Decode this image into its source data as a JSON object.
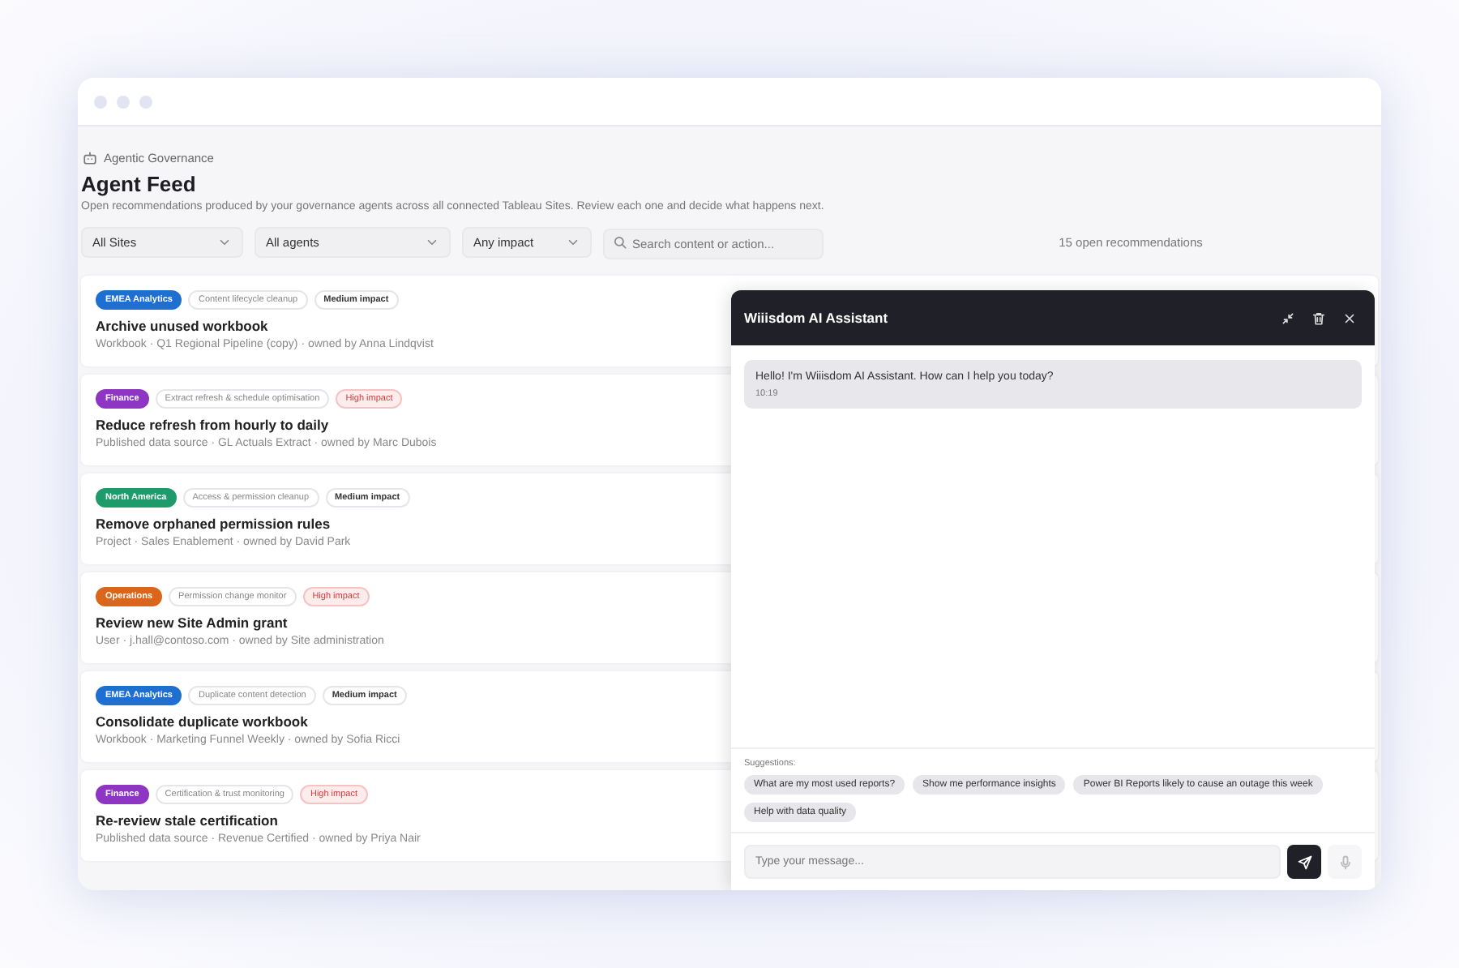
{
  "breadcrumb": "Agentic Governance",
  "title": "Agent Feed",
  "subtitle": "Open recommendations produced by your governance agents across all connected Tableau Sites. Review each one and decide what happens next.",
  "filters": [
    {
      "kind": "select",
      "value": "All Sites"
    },
    {
      "kind": "select",
      "value": "All agents"
    },
    {
      "kind": "select",
      "value": "Any impact"
    },
    {
      "kind": "search",
      "placeholder": "Search content or action..."
    }
  ],
  "count": "15 open recommendations",
  "recommendations": [
    {
      "site": "EMEA Analytics",
      "color": "#1f6fd1",
      "agent": "Content lifecycle cleanup",
      "impact": "Medium impact",
      "kind": "medium",
      "title": "Archive unused workbook",
      "meta": "Workbook · Q1 Regional Pipeline (copy) · owned by Anna Lindqvist"
    },
    {
      "site": "Finance",
      "color": "#8e35c4",
      "agent": "Extract refresh & schedule optimisation",
      "impact": "High impact",
      "kind": "high",
      "title": "Reduce refresh from hourly to daily",
      "meta": "Published data source · GL Actuals Extract · owned by Marc Dubois"
    },
    {
      "site": "North America",
      "color": "#1f9a6a",
      "agent": "Access & permission cleanup",
      "impact": "Medium impact",
      "kind": "medium",
      "title": "Remove orphaned permission rules",
      "meta": "Project · Sales Enablement · owned by David Park"
    },
    {
      "site": "Operations",
      "color": "#d9661a",
      "agent": "Permission change monitor",
      "impact": "High impact",
      "kind": "high",
      "title": "Review new Site Admin grant",
      "meta": "User · j.hall@contoso.com · owned by Site administration"
    },
    {
      "site": "EMEA Analytics",
      "color": "#1f6fd1",
      "agent": "Duplicate content detection",
      "impact": "Medium impact",
      "kind": "medium",
      "title": "Consolidate duplicate workbook",
      "meta": "Workbook · Marketing Funnel Weekly · owned by Sofia Ricci"
    },
    {
      "site": "Finance",
      "color": "#8e35c4",
      "agent": "Certification & trust monitoring",
      "impact": "High impact",
      "kind": "high",
      "title": "Re-review stale certification",
      "meta": "Published data source · Revenue Certified · owned by Priya Nair"
    }
  ],
  "assistant": {
    "title": "Wiiisdom AI Assistant",
    "messages": [
      {
        "text": "Hello! I'm Wiiisdom AI Assistant. How can I help you today?",
        "time": "10:19"
      }
    ],
    "suggestions_label": "Suggestions:",
    "suggestions": [
      "What are my most used reports?",
      "Show me performance insights",
      "Power BI Reports likely to cause an outage this week",
      "Help with data quality"
    ],
    "input_placeholder": "Type your message..."
  }
}
